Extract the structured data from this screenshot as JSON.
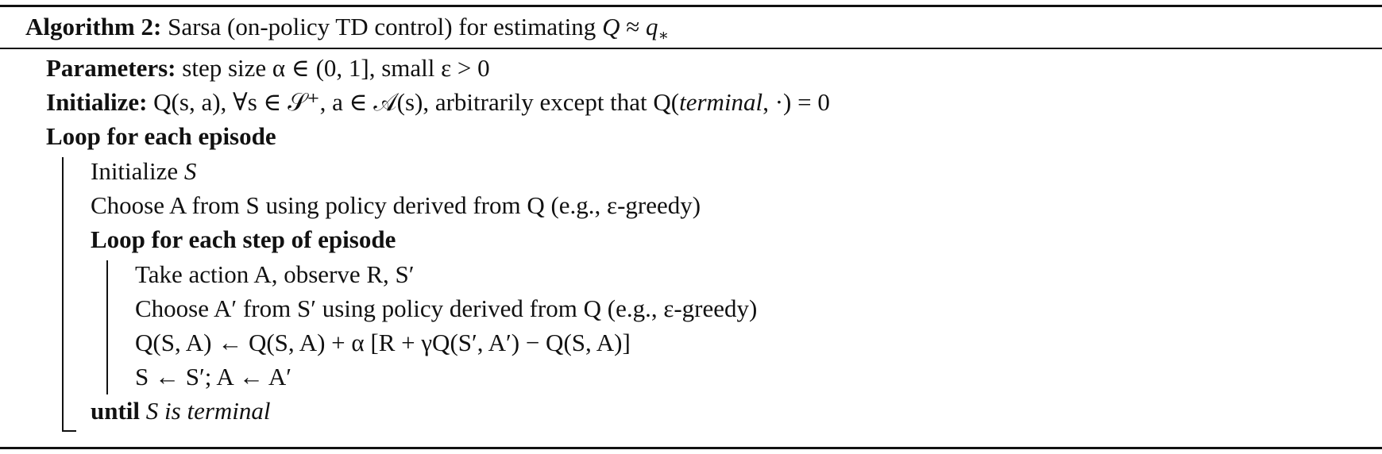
{
  "algorithm": {
    "label": "Algorithm 2:",
    "title_parts": [
      "Sarsa (on-policy TD control) for estimating ",
      "Q",
      " ≈ ",
      "q",
      "∗"
    ]
  },
  "lines": {
    "parameters": {
      "keyword": "Parameters:",
      "text": "step size α ∈ (0, 1], small ε > 0"
    },
    "initialize": {
      "keyword": "Initialize:",
      "text_a": "Q(s, a), ∀s ∈ 𝒮⁺, a ∈ 𝒜(s), arbitrarily except that Q(",
      "text_italic": "terminal",
      "text_b": ", ·) = 0"
    },
    "loop_episode": "Loop for each episode",
    "init_s": {
      "text": "Initialize ",
      "var": "S"
    },
    "choose_a": "Choose A from S using policy derived from Q (e.g., ε-greedy)",
    "loop_step": "Loop for each step of episode",
    "take_action": "Take action A, observe R, S′",
    "choose_a_prime": "Choose A′ from S′ using policy derived from Q (e.g., ε-greedy)",
    "update": "Q(S, A) ← Q(S, A) + α [R + γQ(S′, A′) − Q(S, A)]",
    "assign": "S ← S′; A ← A′",
    "until": {
      "keyword": "until",
      "var": " S ",
      "cond": "is terminal"
    }
  }
}
